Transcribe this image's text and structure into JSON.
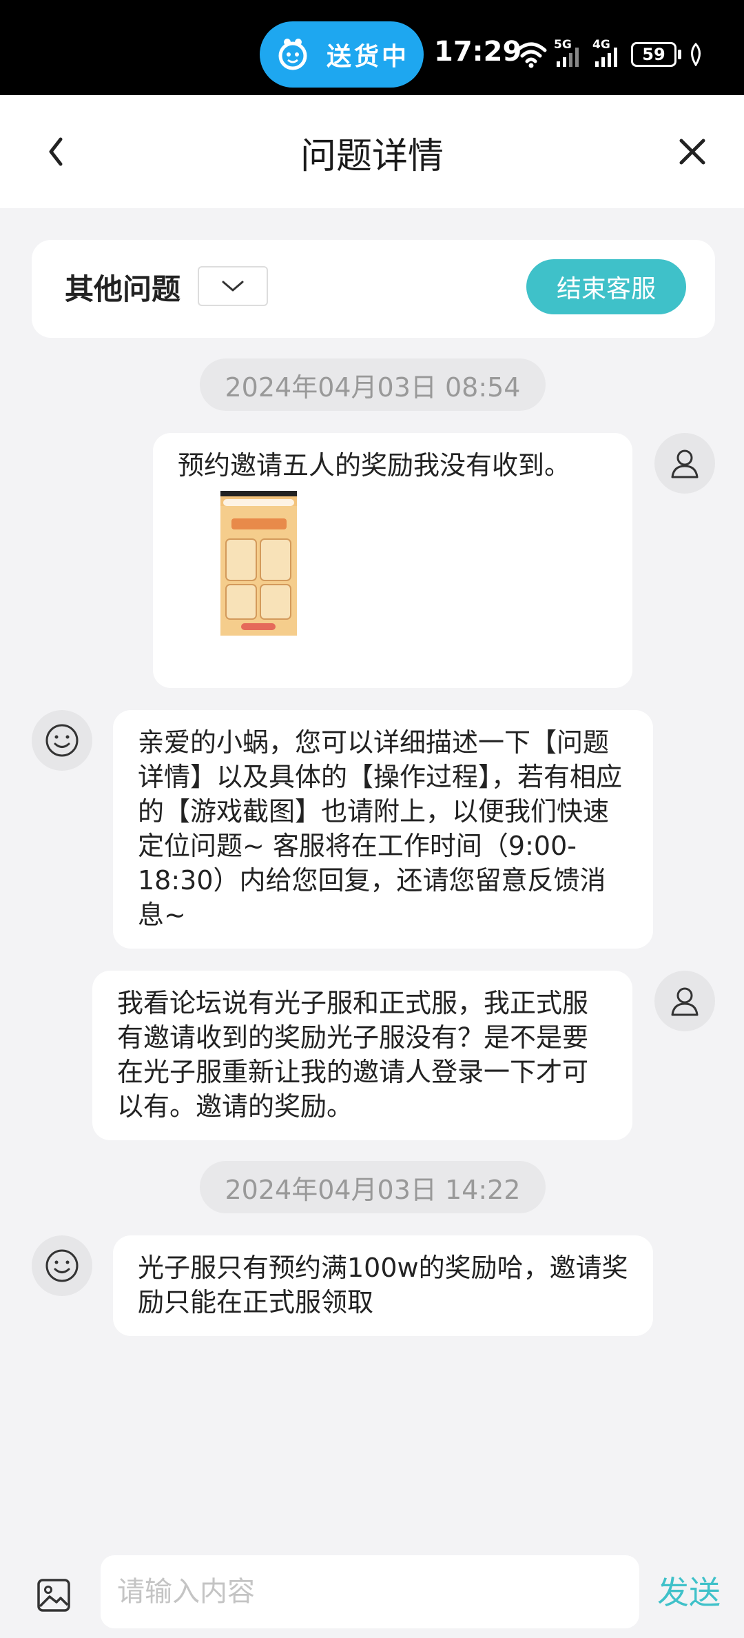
{
  "status_bar": {
    "delivery_label": "送货中",
    "time": "17:29",
    "network_1": "5G",
    "network_2": "4G",
    "battery": "59"
  },
  "header": {
    "title": "问题详情"
  },
  "category": {
    "label": "其他问题",
    "end_service_label": "结束客服"
  },
  "timestamps": [
    "2024年04月03日 08:54",
    "2024年04月03日 14:22"
  ],
  "messages": [
    {
      "sender": "user",
      "text": "预约邀请五人的奖励我没有收到。"
    },
    {
      "sender": "service",
      "text": "亲爱的小蜗，您可以详细描述一下【问题详情】以及具体的【操作过程】，若有相应的【游戏截图】也请附上，以便我们快速定位问题~ 客服将在工作时间（9:00-18:30）内给您回复，还请您留意反馈消息~"
    },
    {
      "sender": "user",
      "text": "我看论坛说有光子服和正式服，我正式服有邀请收到的奖励光子服没有？是不是要在光子服重新让我的邀请人登录一下才可以有。邀请的奖励。"
    },
    {
      "sender": "service",
      "text": "光子服只有预约满100w的奖励哈，邀请奖励只能在正式服领取"
    }
  ],
  "input": {
    "placeholder": "请输入内容",
    "send_label": "发送"
  },
  "colors": {
    "accent": "#3fc1c9",
    "delivery_pill": "#1ea7f0",
    "background": "#f3f3f5"
  },
  "icons": {
    "back": "chevron-left-icon",
    "close": "close-icon",
    "dropdown": "chevron-down-icon",
    "user_avatar": "user-icon",
    "service_avatar": "smiley-icon",
    "image": "image-icon",
    "wifi": "wifi-icon",
    "leaf": "leaf-icon"
  }
}
